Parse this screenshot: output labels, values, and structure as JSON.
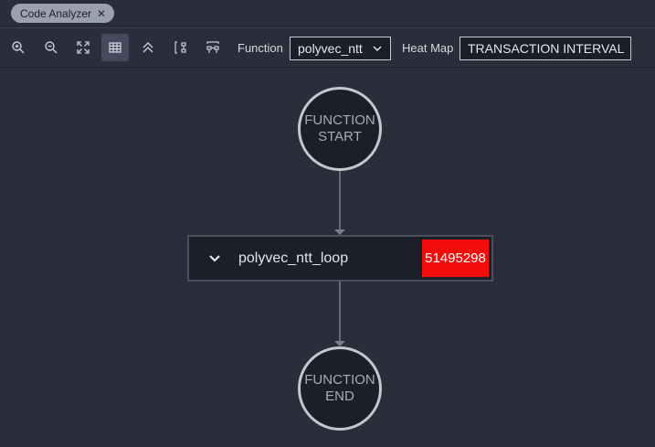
{
  "tabs": [
    {
      "label": "Code Analyzer",
      "close_icon": "close-icon"
    }
  ],
  "toolbar": {
    "buttons": [
      {
        "name": "zoom-in-button",
        "icon": "zoom-in-icon"
      },
      {
        "name": "zoom-out-button",
        "icon": "zoom-out-icon"
      },
      {
        "name": "fit-to-screen-button",
        "icon": "fit-screen-icon"
      },
      {
        "name": "grid-view-button",
        "icon": "table-icon",
        "active": true
      },
      {
        "name": "collapse-all-button",
        "icon": "double-chevron-up-icon"
      },
      {
        "name": "layout-vertical-button",
        "icon": "layout-vertical-icon"
      },
      {
        "name": "layout-horizontal-button",
        "icon": "layout-horizontal-icon"
      }
    ],
    "function_label": "Function",
    "function_value": "polyvec_ntt",
    "heatmap_label": "Heat Map",
    "heatmap_value": "TRANSACTION INTERVAL"
  },
  "graph": {
    "start_node": {
      "line1": "FUNCTION",
      "line2": "START"
    },
    "loop_node": {
      "label": "polyvec_ntt_loop",
      "metric": "51495298",
      "metric_color": "#f40b0b"
    },
    "end_node": {
      "line1": "FUNCTION",
      "line2": "END"
    }
  },
  "colors": {
    "background": "#2b2d3b",
    "node_fill": "#1d1f28",
    "node_border": "#c4c6cc",
    "edge": "#7b7f8d",
    "heat_high": "#f40b0b"
  }
}
